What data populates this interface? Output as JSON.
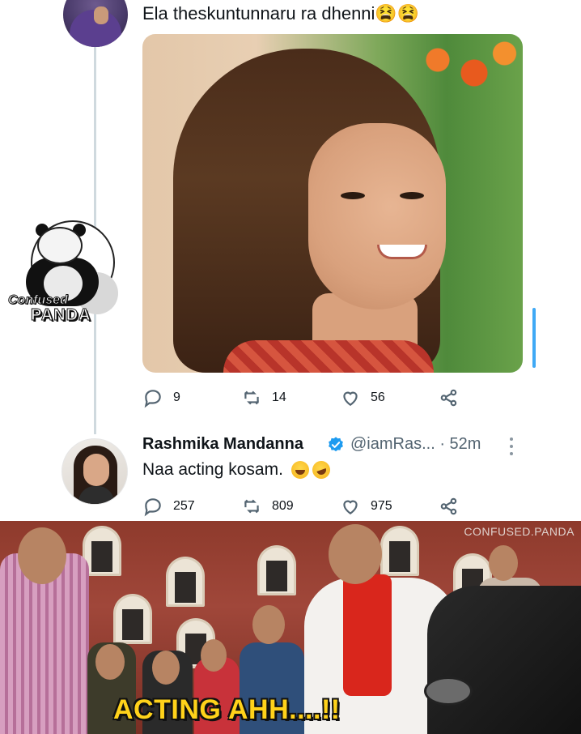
{
  "top_tweet": {
    "text": "Ela theskuntunnaru ra dhenni😫😫",
    "actions": {
      "replies": "9",
      "retweets": "14",
      "likes": "56"
    }
  },
  "watermark_badge": {
    "line1": "Confused",
    "line2": "PANDA"
  },
  "reply_tweet": {
    "name": "Rashmika Mandanna",
    "handle_time": "@iamRas... · 52m",
    "text": "Naa acting kosam.",
    "actions": {
      "replies": "257",
      "retweets": "809",
      "likes": "975"
    }
  },
  "meme": {
    "watermark": "CONFUSED.PANDA",
    "caption": "ACTING AHH....!!"
  },
  "colors": {
    "link_blue": "#1d9bf0",
    "caption_yellow": "#ffd21a",
    "muted": "#536471"
  }
}
